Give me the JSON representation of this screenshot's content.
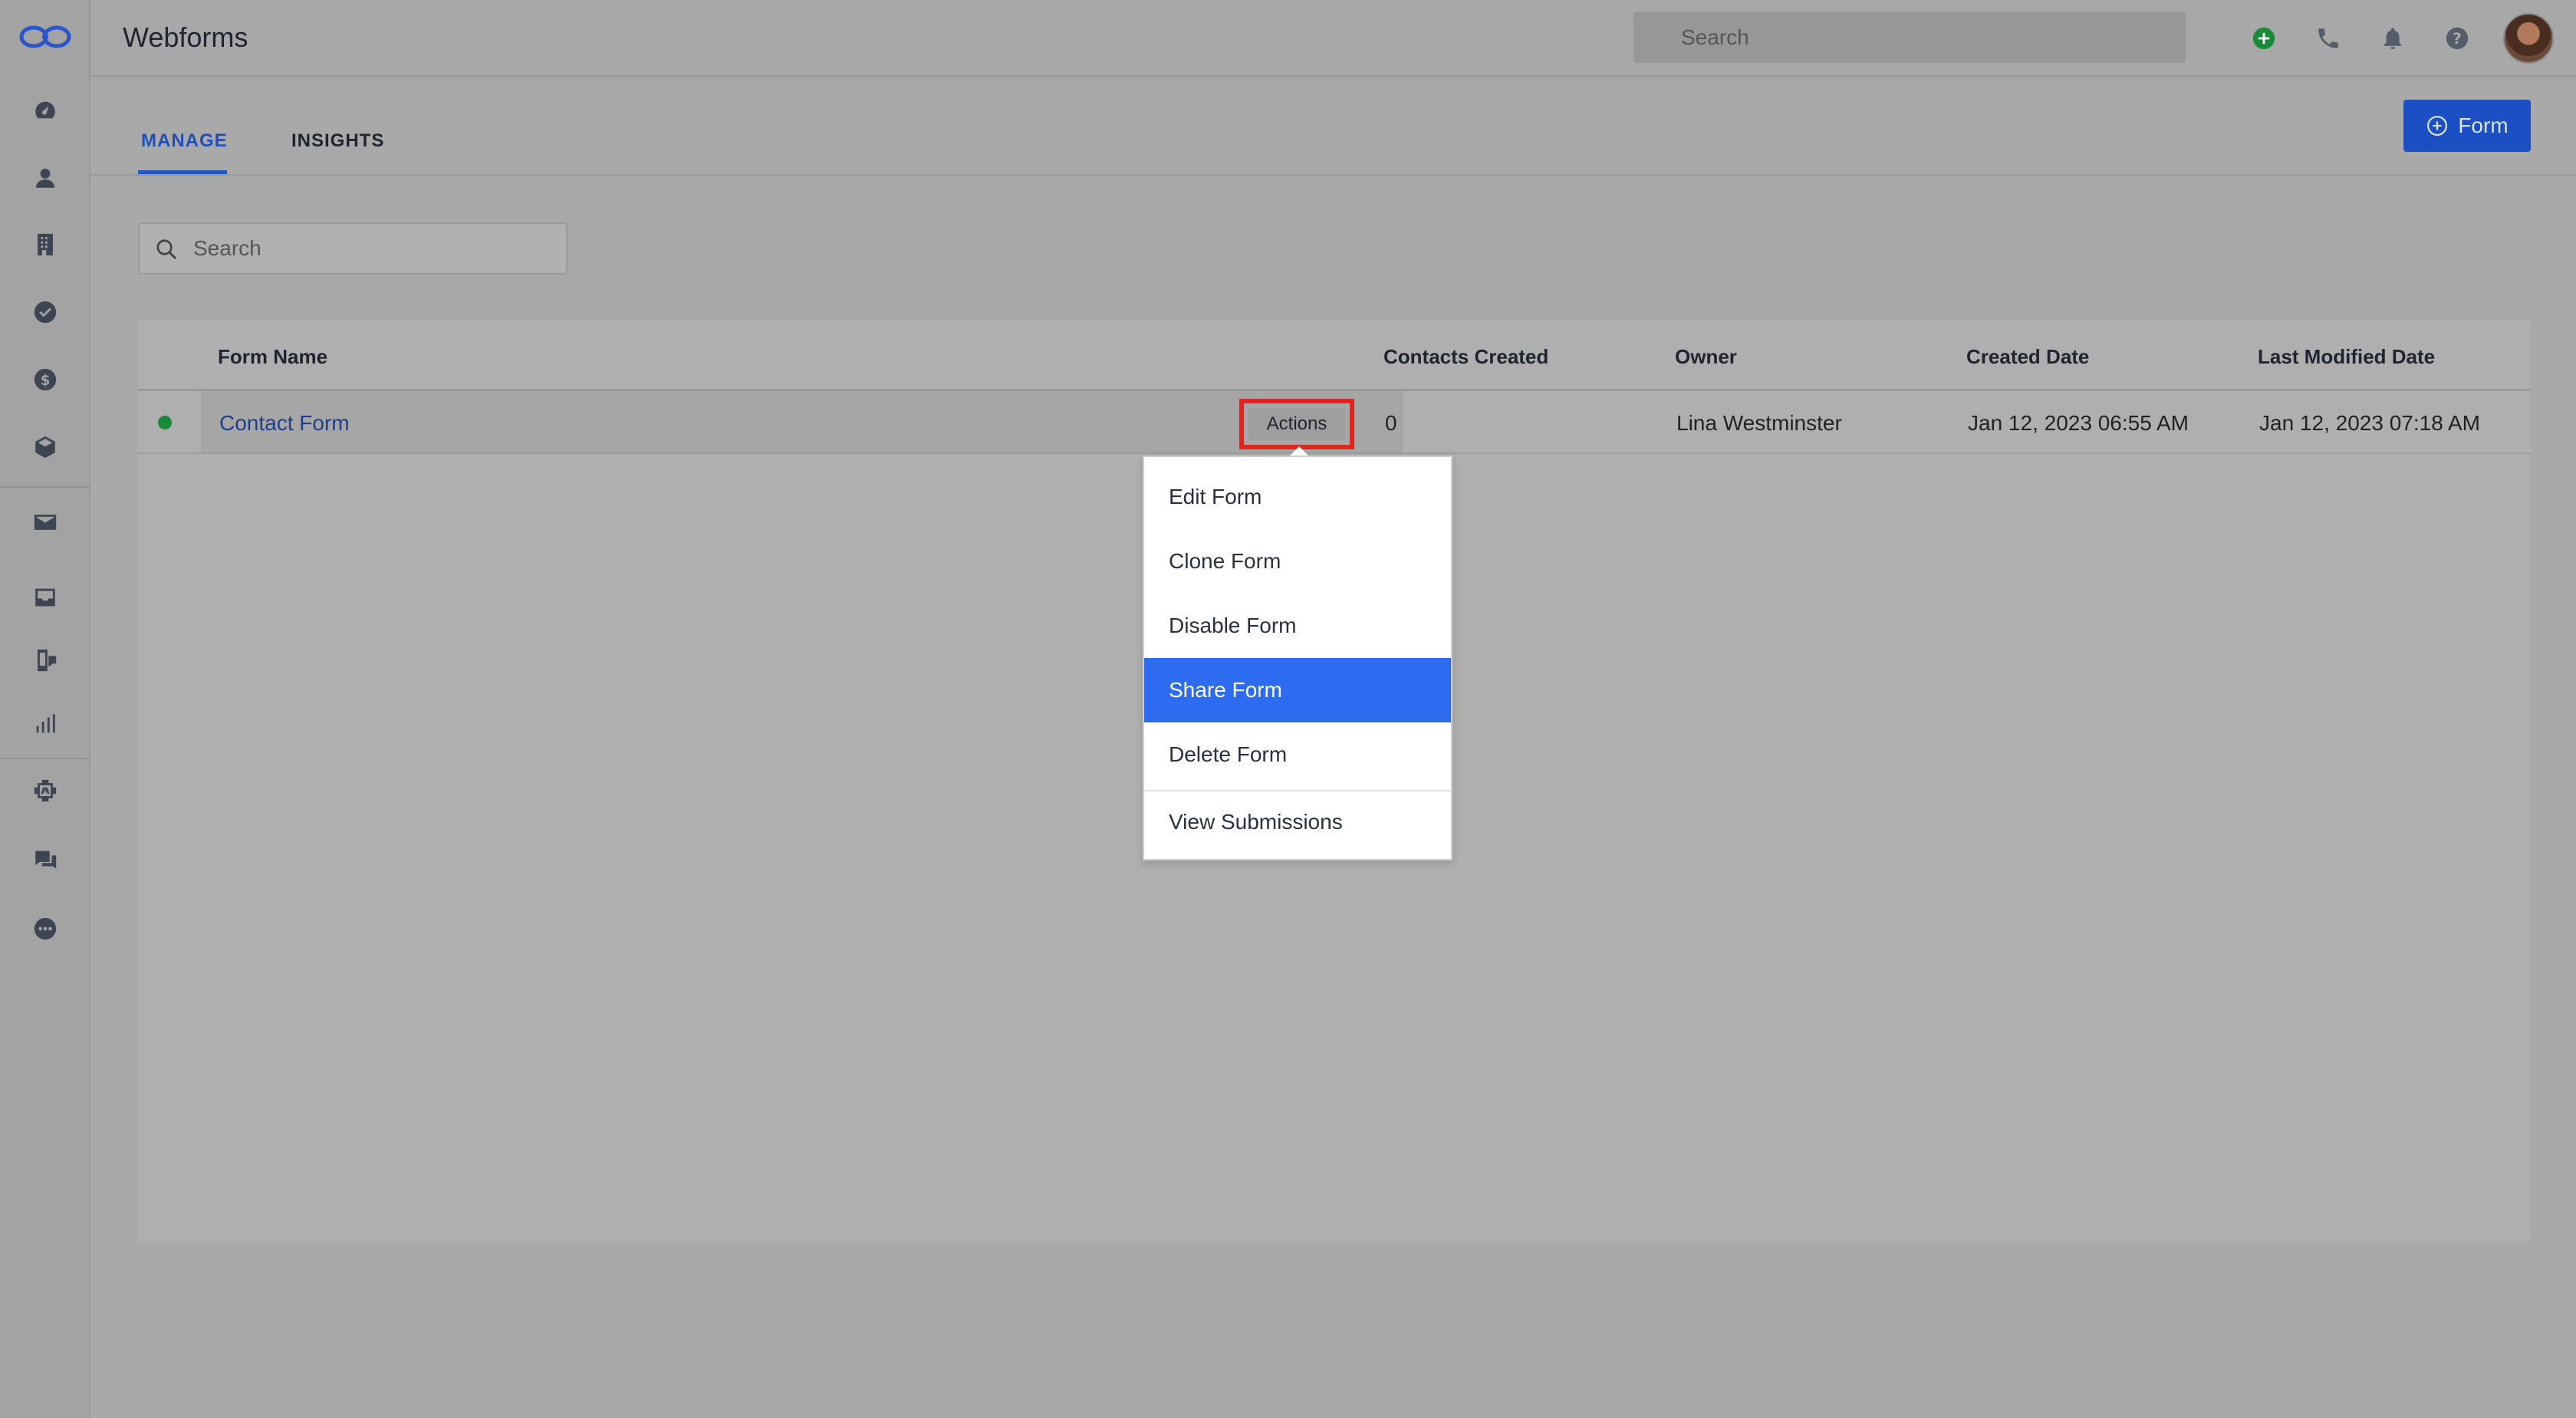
{
  "header": {
    "title": "Webforms",
    "search_placeholder": "Search",
    "icons": [
      "plus-circle-icon",
      "phone-icon",
      "bell-icon",
      "help-icon"
    ]
  },
  "sidebar": {
    "items": [
      "dashboard-icon",
      "contact-icon",
      "building-icon",
      "check-circle-icon",
      "dollar-icon",
      "box-icon",
      "mail-icon",
      "inbox-icon",
      "phone-chat-icon",
      "bar-chart-icon",
      "automation-icon",
      "chat-icon",
      "more-icon"
    ]
  },
  "tabs": [
    {
      "label": "MANAGE",
      "active": true
    },
    {
      "label": "INSIGHTS",
      "active": false
    }
  ],
  "new_form_button": {
    "label": "Form"
  },
  "list_search": {
    "placeholder": "Search"
  },
  "table": {
    "columns": [
      "Form Name",
      "Contacts Created",
      "Owner",
      "Created Date",
      "Last Modified Date"
    ],
    "rows": [
      {
        "name": "Contact Form",
        "status": "active",
        "contacts_created": "0",
        "owner": "Lina Westminster",
        "created_date": "Jan 12, 2023 06:55 AM",
        "modified_date": "Jan 12, 2023 07:18 AM"
      }
    ],
    "actions_label": "Actions"
  },
  "actions_menu": {
    "items": [
      "Edit Form",
      "Clone Form",
      "Disable Form",
      "Share Form",
      "Delete Form",
      "View Submissions"
    ],
    "highlighted": "Share Form"
  },
  "colors": {
    "accent": "#2157c9",
    "highlight": "#2d6cf0",
    "status_active": "#1a8a3a",
    "callout": "#e0261c"
  }
}
